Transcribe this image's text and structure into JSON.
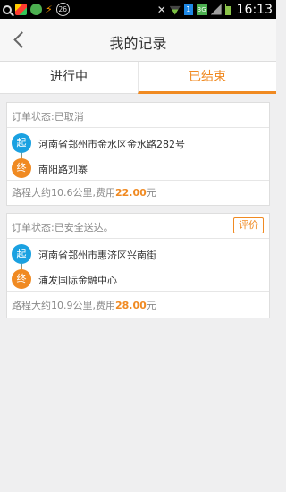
{
  "status_bar": {
    "time": "16:13",
    "badge": "26",
    "network": "3G",
    "blue_icon": "1"
  },
  "header": {
    "title": "我的记录",
    "back_icon": "back-arrow-icon"
  },
  "tabs": [
    {
      "label": "进行中",
      "active": false
    },
    {
      "label": "已结束",
      "active": true
    }
  ],
  "orders": [
    {
      "status": "订单状态:已取消",
      "start_marker": "起",
      "start": "河南省郑州市金水区金水路282号",
      "end_marker": "终",
      "end": "南阳路刘寨",
      "summary_prefix": "路程大约10.6公里,费用",
      "fee": "22.00",
      "fee_unit": "元"
    },
    {
      "status": "订单状态:已安全送达。",
      "rate_label": "评价",
      "start_marker": "起",
      "start": "河南省郑州市惠济区兴南街",
      "end_marker": "终",
      "end": "浦发国际金融中心",
      "summary_prefix": "路程大约10.9公里,费用",
      "fee": "28.00",
      "fee_unit": "元"
    }
  ],
  "colors": {
    "accent": "#f08a22",
    "start_pin": "#1aa1e1",
    "end_pin": "#f08a22",
    "background": "#efeff0"
  }
}
